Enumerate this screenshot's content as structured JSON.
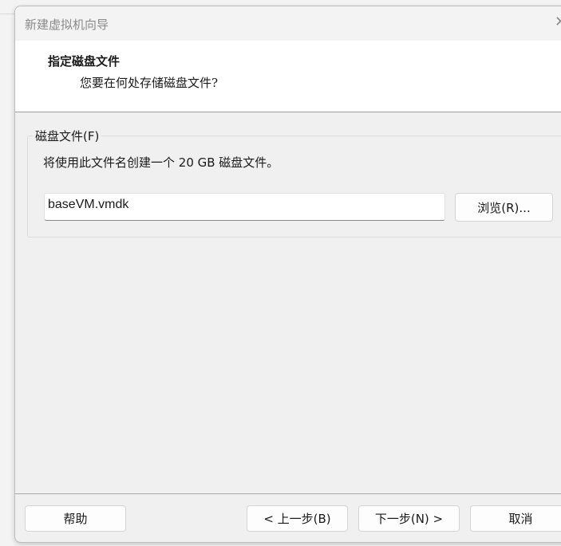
{
  "window": {
    "title": "新建虚拟机向导",
    "close_glyph": "✕"
  },
  "header": {
    "title": "指定磁盘文件",
    "subtitle": "您要在何处存储磁盘文件?"
  },
  "group": {
    "label": "磁盘文件(F)",
    "description": "将使用此文件名创建一个 20 GB 磁盘文件。",
    "file_value": "baseVM.vmdk",
    "browse_label": "浏览(R)..."
  },
  "footer": {
    "help": "帮助",
    "back": "< 上一步(B)",
    "next": "下一步(N) >",
    "cancel": "取消"
  }
}
